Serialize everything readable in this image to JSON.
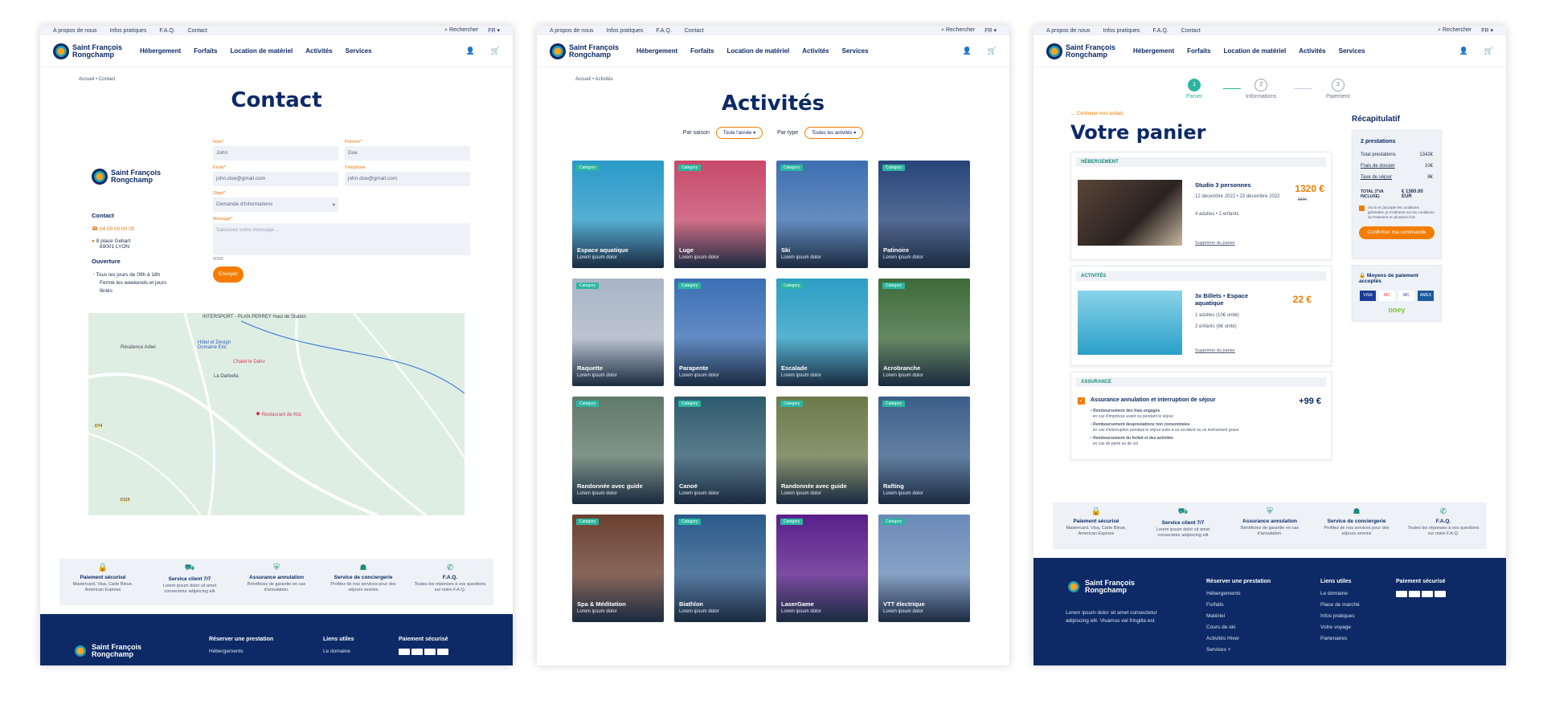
{
  "topbar": {
    "links": [
      "A propos de nous",
      "Infos pratiques",
      "F.A.Q.",
      "Contact"
    ],
    "search": "Rechercher",
    "lang": "FR"
  },
  "brand": {
    "line1": "Saint François",
    "line2": "Rongchamp"
  },
  "nav": [
    "Hébergement",
    "Forfaits",
    "Location de matériel",
    "Activités",
    "Services"
  ],
  "contact": {
    "breadcrumb": "Accueil • Contact",
    "title": "Contact",
    "contact_heading": "Contact",
    "phone": "04 00 00 00 00",
    "address": [
      "8 place Gebart",
      "69001 LYON"
    ],
    "hours_heading": "Ouverture",
    "hours": [
      "Tous les jours de 09h à 18h",
      "Fermé les weekends et jours fériés"
    ],
    "fields": {
      "nom_label": "Nom*",
      "nom_value": "John",
      "prenom_label": "Prénom*",
      "prenom_value": "Doe",
      "email_label": "Email*",
      "email_value": "john.doe@gmail.com",
      "tel_label": "Téléphone",
      "tel_value": "john.doe@gmail.com",
      "objet_label": "Objet*",
      "objet_value": "Demande d'informations",
      "message_label": "Message*",
      "message_placeholder": "Saisissez votre message...",
      "counter": "0/300"
    },
    "submit": "Envoyer",
    "map_labels": [
      "INTERSPORT - PLAN PERREY Haut de Station",
      "Résidence Arbel",
      "Hôtel et Design Domaine Etic",
      "Chalet le Dahu",
      "La Darbella",
      "Restaurant de Kitz",
      "D74",
      "D119"
    ]
  },
  "features": [
    {
      "icon": "lock-icon",
      "title": "Paiement sécurisé",
      "desc": "Mastercard, Visa, Carte Bleue, American Express"
    },
    {
      "icon": "truck-icon",
      "title": "Service client 7/7",
      "desc": "Lorem ipsum dolor sit amet consectetur adipiscing elit"
    },
    {
      "icon": "shield-icon",
      "title": "Assurance annulation",
      "desc": "Bénéficiez de garantie en cas d'annulation."
    },
    {
      "icon": "concierge-icon",
      "title": "Service de conciergerie",
      "desc": "Profitez de nos services pour des séjours sereins"
    },
    {
      "icon": "chat-icon",
      "title": "F.A.Q.",
      "desc": "Toutes les réponses à vos questions sur notre F.A.Q."
    }
  ],
  "footer": {
    "reserve_heading": "Réserver une prestation",
    "reserve_links": [
      "Hébergements",
      "Forfaits",
      "Matériel",
      "Cours de ski",
      "Activités Hiver",
      "Services +"
    ],
    "useful_heading": "Liens utiles",
    "useful_links": [
      "Le domaine",
      "Place de marché",
      "Infos pratiques",
      "Votre voyage",
      "Partenaires"
    ],
    "payment_heading": "Paiement sécurisé",
    "about": "Lorem ipsum dolor sit amet consectetur adipiscing elit. Vivamus vel fringilla est."
  },
  "activities": {
    "breadcrumb": "Accueil • Activités",
    "title": "Activités",
    "filter_season_label": "Par saison",
    "filter_season_value": "Toute l'année",
    "filter_type_label": "Par type",
    "filter_type_value": "Toutes les activités",
    "category": "Category",
    "subtitle": "Lorem ipsum dolor",
    "items": [
      "Espace aquatique",
      "Luge",
      "Ski",
      "Patinoire",
      "Raquette",
      "Parapente",
      "Escalade",
      "Acrobranche",
      "Randonnée avec guide",
      "Canoë",
      "Randonnée avec guide",
      "Rafting",
      "Spa & Méditation",
      "Biathlon",
      "LaserGame",
      "VTT électrique"
    ],
    "colors": [
      "#2a9ac8",
      "#c74a6a",
      "#3d6fb0",
      "#27457a",
      "#a9b5c6",
      "#3b6fb5",
      "#2c9ec4",
      "#3e6b3a",
      "#5f7a6a",
      "#2f5b6e",
      "#6b7a4a",
      "#3b5f8a",
      "#6b4030",
      "#2b5a8a",
      "#5a1f8a",
      "#6a8ab8"
    ]
  },
  "cart": {
    "steps": [
      "Panier",
      "Informations",
      "Paiement"
    ],
    "continue": "Continuer mes achats",
    "title": "Votre panier",
    "hebergement_heading": "HÉBERGEMENT",
    "hebergement_name": "Studio 3 personnes",
    "hebergement_dates": "12 décembre 2022 • 23 décembre 2022",
    "hebergement_people": "4 adultes • 2 enfants",
    "hebergement_price": "1320 €",
    "hebergement_old": "320€",
    "remove": "Supprimer du panier",
    "activites_heading": "ACTIVITÉS",
    "activite_name": "3x Billets • Espace aquatique",
    "activite_people": "1 adultes (10€ unité)",
    "activite_kids": "2 enfants (6€ unité)",
    "activite_price": "22 €",
    "assurance_heading": "ASSURANCE",
    "assurance_name": "Assurance annulation et interruption de séjour",
    "assurance_price": "+99 €",
    "assurance_points": [
      {
        "b": "Remboursement des frais engagés",
        "s": "en cas d'imprévus avant ou pendant le séjour"
      },
      {
        "b": "Remboursement desprestations non consommées",
        "s": "en cas d'interruption pendant le séjour suite à un accident ou un événement grave"
      },
      {
        "b": "Remboursement du forfait et des activités",
        "s": "en cas de perte ou de vol"
      }
    ],
    "recap_title": "Récapitulatif",
    "recap_count": "2 prestations",
    "recap_rows": [
      {
        "k": "Total prestations",
        "v": "1342€"
      },
      {
        "k": "Frais de dossier",
        "v": "10€"
      },
      {
        "k": "Taxe de séjour",
        "v": "8€"
      }
    ],
    "recap_total_label": "TOTAL (TVA INCLUSE)",
    "recap_total": "€ 1360.00 EUR",
    "cgv": "J'ai lu et j'accepte les conditions générales, je m'informe sur les conditions du Paiement en plusieurs fois",
    "confirm": "Confirmer ma commande",
    "payment_title": "Moyens de paiement acceptés",
    "payment_cards": [
      "VISA",
      "MC",
      "MC",
      "AMEX"
    ],
    "oney": "oney"
  }
}
